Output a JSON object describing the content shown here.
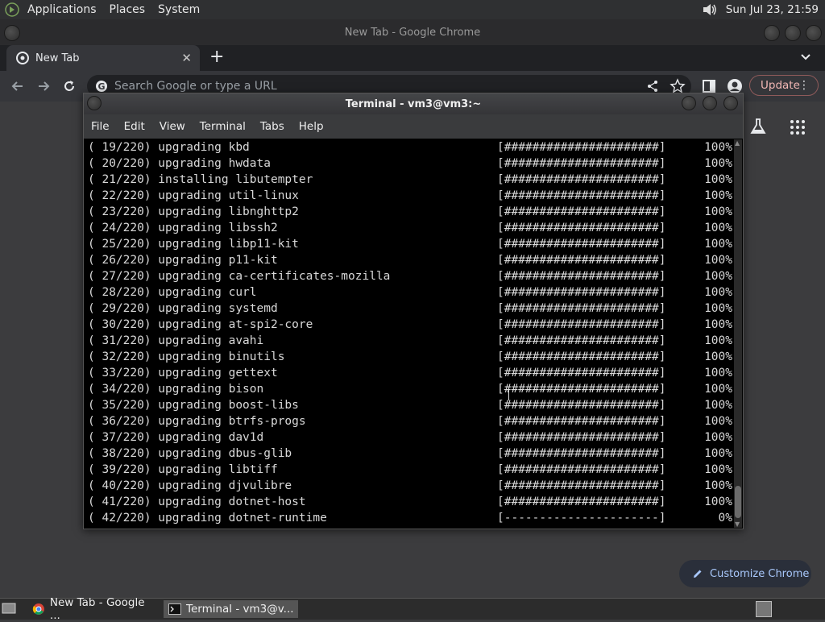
{
  "top_panel": {
    "menus": [
      "Applications",
      "Places",
      "System"
    ],
    "clock": "Sun Jul 23, 21:59"
  },
  "chrome": {
    "window_title": "New Tab - Google Chrome",
    "tab_title": "New Tab",
    "omnibox_placeholder": "Search Google or type a URL",
    "update_label": "Update",
    "customize_label": "Customize Chrome"
  },
  "terminal": {
    "title": "Terminal - vm3@vm3:~",
    "menus": [
      "File",
      "Edit",
      "View",
      "Terminal",
      "Tabs",
      "Help"
    ],
    "lines": [
      {
        "text": "( 19/220) upgrading kbd",
        "bar": "[######################]",
        "pct": "100%"
      },
      {
        "text": "( 20/220) upgrading hwdata",
        "bar": "[######################]",
        "pct": "100%"
      },
      {
        "text": "( 21/220) installing libutempter",
        "bar": "[######################]",
        "pct": "100%"
      },
      {
        "text": "( 22/220) upgrading util-linux",
        "bar": "[######################]",
        "pct": "100%"
      },
      {
        "text": "( 23/220) upgrading libnghttp2",
        "bar": "[######################]",
        "pct": "100%"
      },
      {
        "text": "( 24/220) upgrading libssh2",
        "bar": "[######################]",
        "pct": "100%"
      },
      {
        "text": "( 25/220) upgrading libp11-kit",
        "bar": "[######################]",
        "pct": "100%"
      },
      {
        "text": "( 26/220) upgrading p11-kit",
        "bar": "[######################]",
        "pct": "100%"
      },
      {
        "text": "( 27/220) upgrading ca-certificates-mozilla",
        "bar": "[######################]",
        "pct": "100%"
      },
      {
        "text": "( 28/220) upgrading curl",
        "bar": "[######################]",
        "pct": "100%"
      },
      {
        "text": "( 29/220) upgrading systemd",
        "bar": "[######################]",
        "pct": "100%"
      },
      {
        "text": "( 30/220) upgrading at-spi2-core",
        "bar": "[######################]",
        "pct": "100%"
      },
      {
        "text": "( 31/220) upgrading avahi",
        "bar": "[######################]",
        "pct": "100%"
      },
      {
        "text": "( 32/220) upgrading binutils",
        "bar": "[######################]",
        "pct": "100%"
      },
      {
        "text": "( 33/220) upgrading gettext",
        "bar": "[######################]",
        "pct": "100%"
      },
      {
        "text": "( 34/220) upgrading bison",
        "bar": "[######################]",
        "pct": "100%"
      },
      {
        "text": "( 35/220) upgrading boost-libs",
        "bar": "[######################]",
        "pct": "100%"
      },
      {
        "text": "( 36/220) upgrading btrfs-progs",
        "bar": "[######################]",
        "pct": "100%"
      },
      {
        "text": "( 37/220) upgrading dav1d",
        "bar": "[######################]",
        "pct": "100%"
      },
      {
        "text": "( 38/220) upgrading dbus-glib",
        "bar": "[######################]",
        "pct": "100%"
      },
      {
        "text": "( 39/220) upgrading libtiff",
        "bar": "[######################]",
        "pct": "100%"
      },
      {
        "text": "( 40/220) upgrading djvulibre",
        "bar": "[######################]",
        "pct": "100%"
      },
      {
        "text": "( 41/220) upgrading dotnet-host",
        "bar": "[######################]",
        "pct": "100%"
      },
      {
        "text": "( 42/220) upgrading dotnet-runtime",
        "bar": "[----------------------]",
        "pct": "0%"
      }
    ]
  },
  "taskbar": {
    "tasks": [
      {
        "label": "New Tab - Google ...",
        "icon": "chrome-icon"
      },
      {
        "label": "Terminal - vm3@v...",
        "icon": "terminal-icon"
      }
    ]
  },
  "colors": {
    "chrome_toolbar": "#35363a",
    "terminal_bg": "#000000",
    "accent_update": "#f2b8b5",
    "accent_customize": "#a8c7fa"
  }
}
